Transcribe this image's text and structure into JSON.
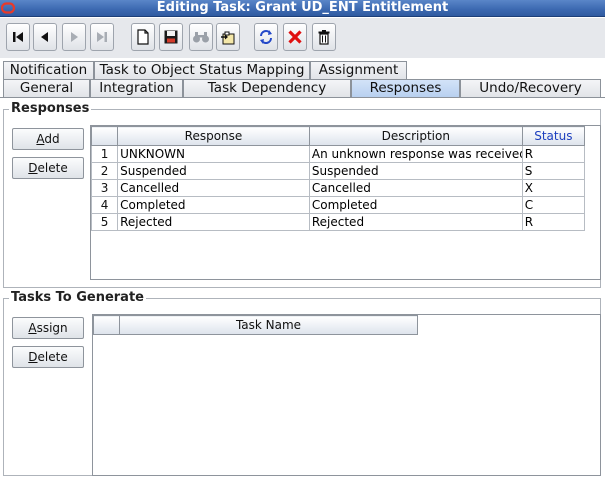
{
  "window": {
    "title": "Editing Task: Grant UD_ENT Entitlement"
  },
  "toolbar": {
    "buttons": [
      {
        "name": "first-record",
        "icon": "first-record-icon"
      },
      {
        "name": "previous-record",
        "icon": "previous-record-icon"
      },
      {
        "name": "next-record",
        "icon": "next-record-icon"
      },
      {
        "name": "last-record",
        "icon": "last-record-icon"
      },
      {
        "name": "new",
        "icon": "new-document-icon"
      },
      {
        "name": "save",
        "icon": "save-icon"
      },
      {
        "name": "find",
        "icon": "binoculars-icon"
      },
      {
        "name": "assign",
        "icon": "assign-icon"
      },
      {
        "name": "refresh",
        "icon": "refresh-icon"
      },
      {
        "name": "cancel",
        "icon": "close-icon"
      },
      {
        "name": "delete",
        "icon": "trash-icon"
      }
    ]
  },
  "tabs": {
    "row1": [
      "Notification",
      "Task to Object Status Mapping",
      "Assignment"
    ],
    "row2": [
      "General",
      "Integration",
      "Task Dependency",
      "Responses",
      "Undo/Recovery"
    ],
    "active": "Responses"
  },
  "responses": {
    "title": "Responses",
    "add_label": "Add",
    "add_mnemonic": "A",
    "add_rest": "dd",
    "delete_label": "Delete",
    "delete_mnemonic": "D",
    "delete_rest": "elete",
    "columns": [
      "Response",
      "Description",
      "Status"
    ],
    "rows": [
      {
        "num": "1",
        "response": "UNKNOWN",
        "description": "An unknown response was received",
        "status": "R"
      },
      {
        "num": "2",
        "response": "Suspended",
        "description": "Suspended",
        "status": "S"
      },
      {
        "num": "3",
        "response": "Cancelled",
        "description": "Cancelled",
        "status": "X"
      },
      {
        "num": "4",
        "response": "Completed",
        "description": "Completed",
        "status": "C"
      },
      {
        "num": "5",
        "response": "Rejected",
        "description": "Rejected",
        "status": "R"
      }
    ]
  },
  "tasks_to_generate": {
    "title": "Tasks To Generate",
    "assign_label": "Assign",
    "assign_mnemonic": "A",
    "assign_rest": "ssign",
    "delete_label": "Delete",
    "delete_mnemonic": "D",
    "delete_rest": "elete",
    "columns": [
      "Task Name"
    ]
  },
  "colors": {
    "titlebar": "#3b68b0",
    "active_tab": "#c3d7f3",
    "status_header": "#1d3fbf",
    "cancel_icon": "#e01010"
  }
}
